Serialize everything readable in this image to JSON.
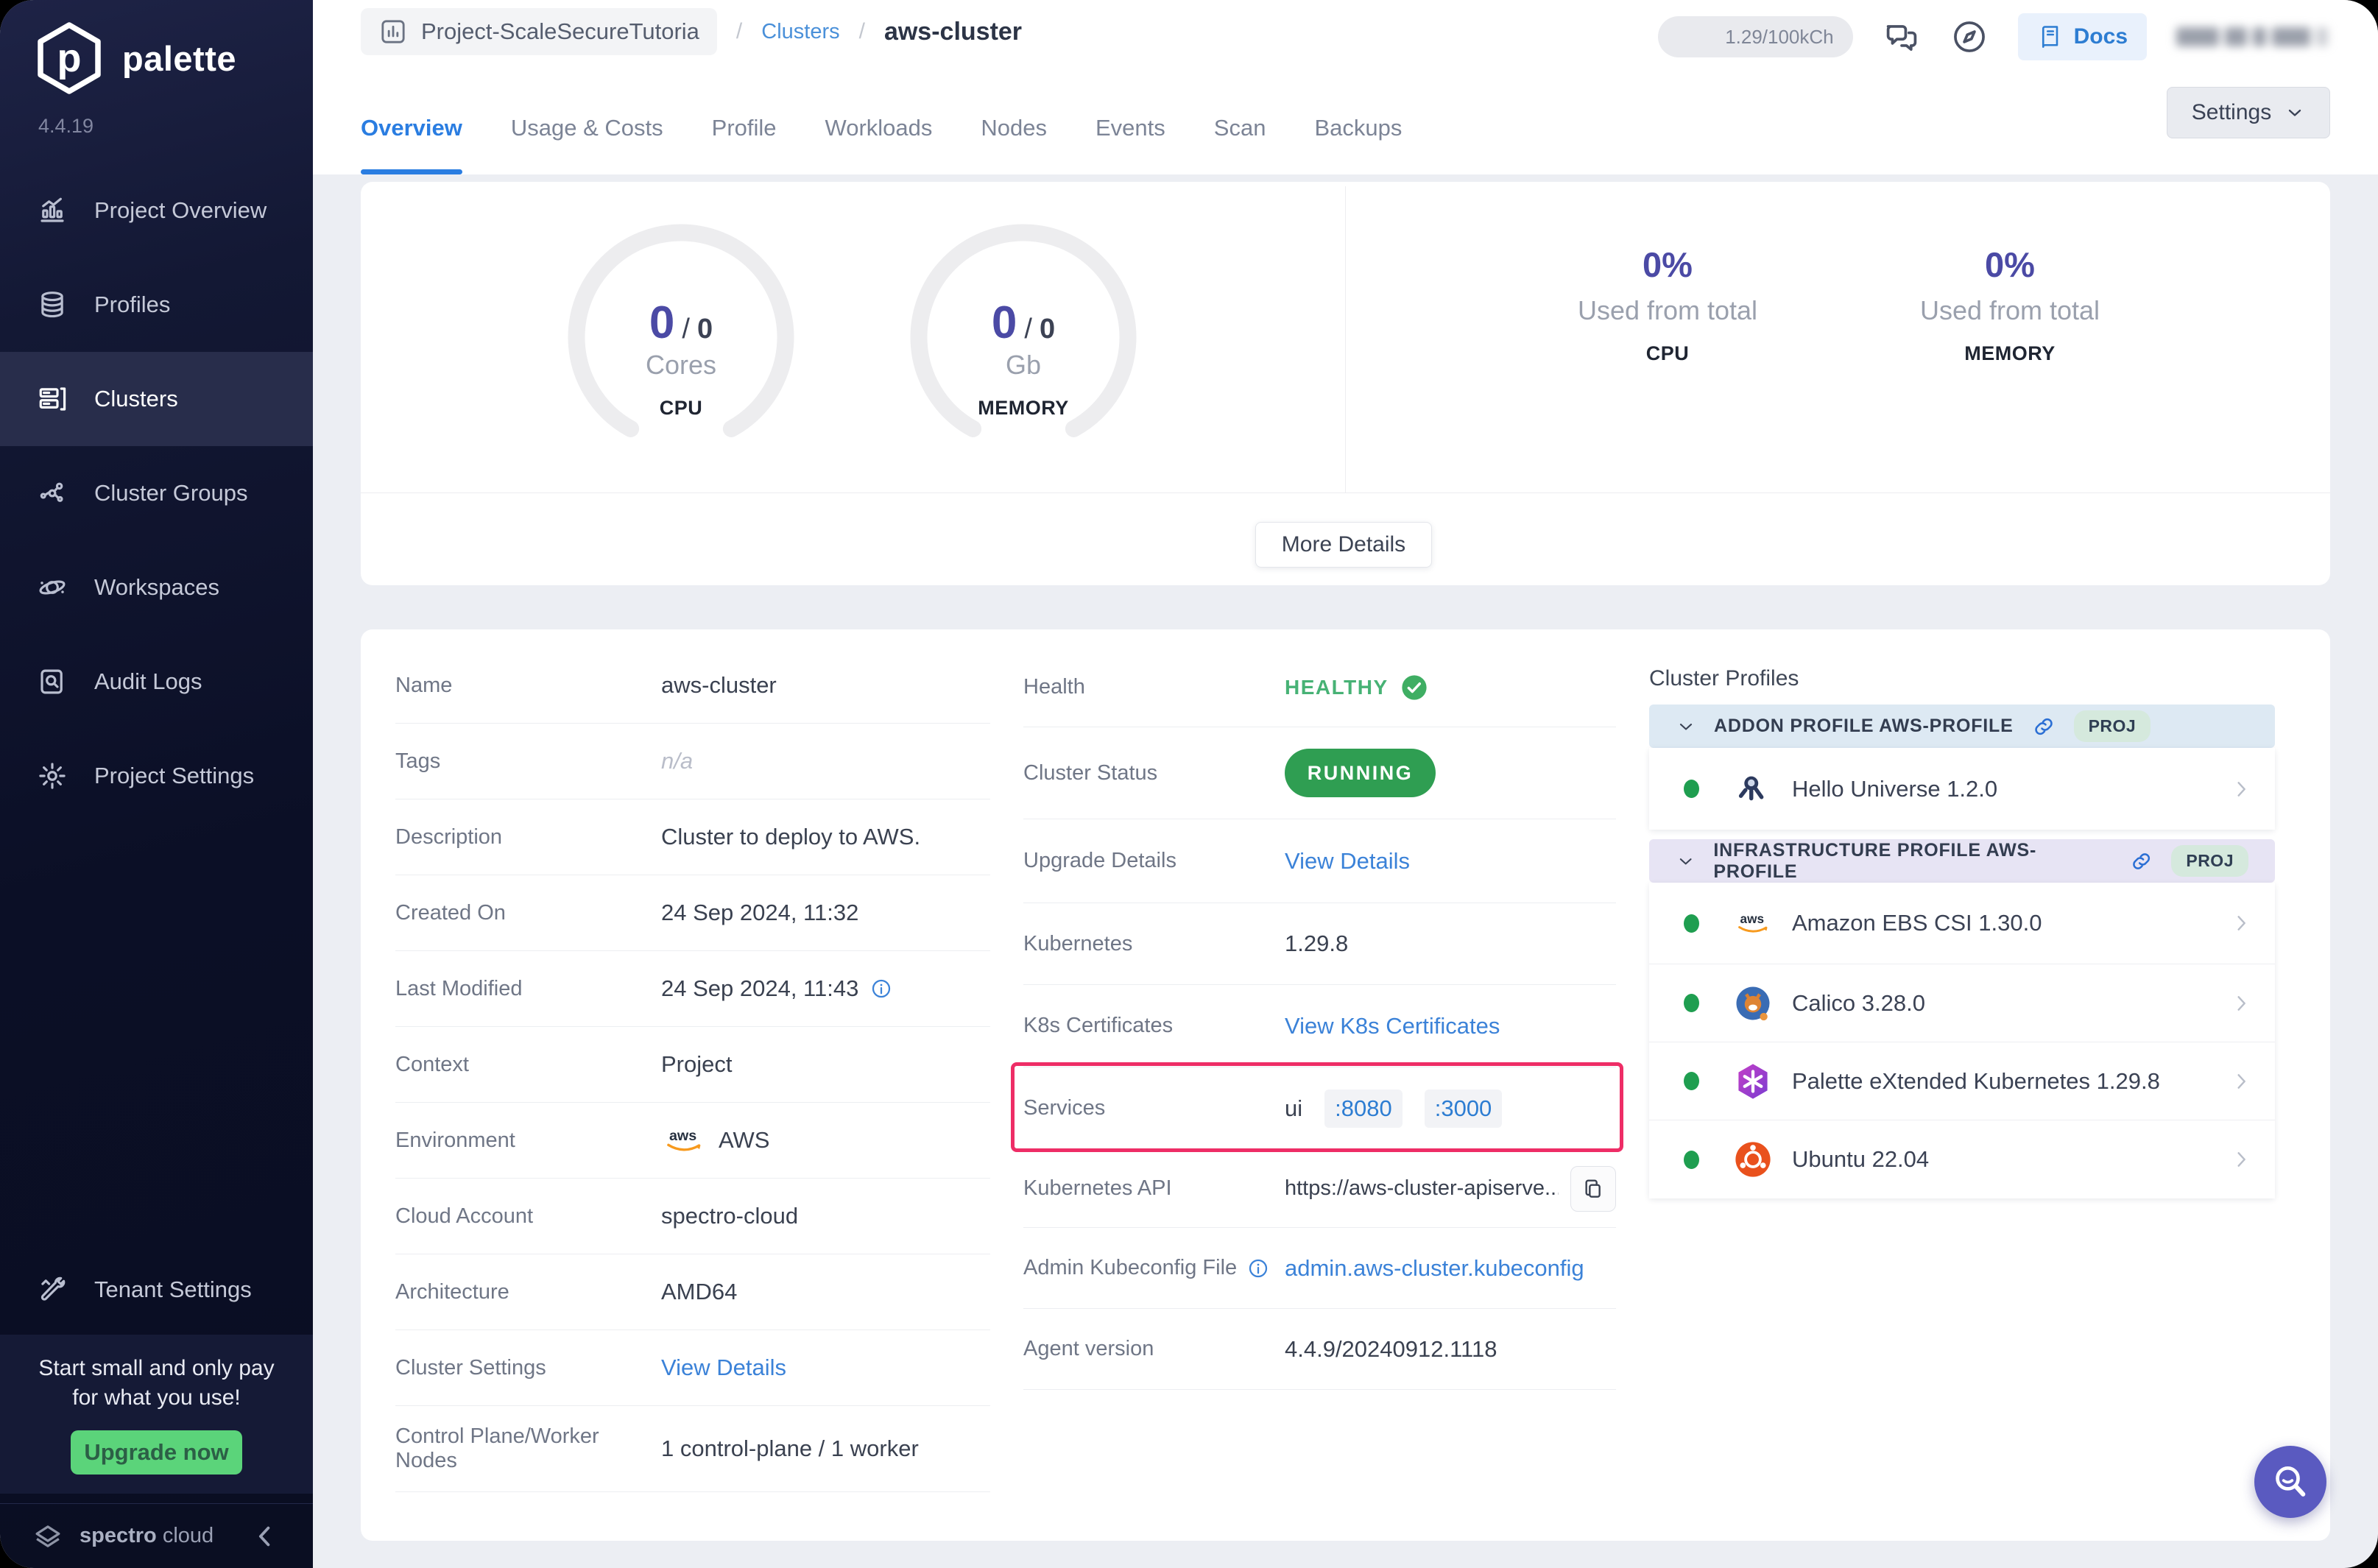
{
  "colors": {
    "accent_blue": "#2a7de1",
    "link_blue": "#3b82d8",
    "purple_metric": "#4b4aa5",
    "status_green": "#2f9e52",
    "healthy_green": "#47b275",
    "pink_highlight": "#ee2d66",
    "upgrade_green": "#5bd47a",
    "sidebar_navy": "#0d1128",
    "help_fab_purple": "#5a5ac0"
  },
  "sidebar": {
    "brand": "palette",
    "version": "4.4.19",
    "items": [
      {
        "label": "Project Overview",
        "icon": "project-overview",
        "active": false
      },
      {
        "label": "Profiles",
        "icon": "profiles",
        "active": false
      },
      {
        "label": "Clusters",
        "icon": "clusters",
        "active": true
      },
      {
        "label": "Cluster Groups",
        "icon": "cluster-groups",
        "active": false
      },
      {
        "label": "Workspaces",
        "icon": "workspaces",
        "active": false
      },
      {
        "label": "Audit Logs",
        "icon": "audit-logs",
        "active": false
      },
      {
        "label": "Project Settings",
        "icon": "project-settings",
        "active": false
      }
    ],
    "tenant": {
      "label": "Tenant Settings",
      "icon": "tools"
    },
    "promo": {
      "line1": "Start small and only pay",
      "line2": "for what you use!",
      "button": "Upgrade now"
    },
    "footer": {
      "brand_primary": "spectro",
      "brand_secondary": "cloud"
    }
  },
  "header": {
    "breadcrumb": {
      "project": "Project-ScaleSecureTutoria",
      "separator": "/",
      "section": "Clusters",
      "current": "aws-cluster"
    },
    "usage_pill": "1.29/100kCh",
    "docs_label": "Docs",
    "settings_label": "Settings"
  },
  "tabs": [
    {
      "label": "Overview",
      "active": true
    },
    {
      "label": "Usage & Costs",
      "active": false
    },
    {
      "label": "Profile",
      "active": false
    },
    {
      "label": "Workloads",
      "active": false
    },
    {
      "label": "Nodes",
      "active": false
    },
    {
      "label": "Events",
      "active": false
    },
    {
      "label": "Scan",
      "active": false
    },
    {
      "label": "Backups",
      "active": false
    }
  ],
  "overview_card": {
    "ratio_separator": "/",
    "gauges": [
      {
        "used": "0",
        "total": "0",
        "unit": "Cores",
        "caption": "CPU"
      },
      {
        "used": "0",
        "total": "0",
        "unit": "Gb",
        "caption": "MEMORY"
      }
    ],
    "usage_stats": [
      {
        "percent": "0%",
        "caption": "Used from total",
        "metric": "CPU"
      },
      {
        "percent": "0%",
        "caption": "Used from total",
        "metric": "MEMORY"
      }
    ],
    "more_details_label": "More Details"
  },
  "details": {
    "left_rows": [
      {
        "label": "Name",
        "type": "text",
        "value": "aws-cluster"
      },
      {
        "label": "Tags",
        "type": "muted",
        "value": "n/a"
      },
      {
        "label": "Description",
        "type": "text",
        "value": "Cluster to deploy to AWS."
      },
      {
        "label": "Created On",
        "type": "text",
        "value": "24 Sep 2024, 11:32"
      },
      {
        "label": "Last Modified",
        "type": "text-info",
        "value": "24 Sep 2024, 11:43"
      },
      {
        "label": "Context",
        "type": "text",
        "value": "Project"
      },
      {
        "label": "Environment",
        "type": "aws-text",
        "value": "AWS"
      },
      {
        "label": "Cloud Account",
        "type": "text",
        "value": "spectro-cloud"
      },
      {
        "label": "Architecture",
        "type": "text",
        "value": "AMD64"
      },
      {
        "label": "Cluster Settings",
        "type": "link",
        "value": "View Details"
      },
      {
        "label": "Control Plane/Worker Nodes",
        "type": "text",
        "value": "1 control-plane / 1 worker"
      }
    ],
    "middle_rows": [
      {
        "label": "Health",
        "type": "health",
        "value": "HEALTHY"
      },
      {
        "label": "Cluster Status",
        "type": "running",
        "value": "RUNNING"
      },
      {
        "label": "Upgrade Details",
        "type": "link",
        "value": "View Details"
      },
      {
        "label": "Kubernetes",
        "type": "text",
        "value": "1.29.8"
      },
      {
        "label": "K8s Certificates",
        "type": "link",
        "value": "View K8s Certificates"
      },
      {
        "label": "Services",
        "type": "services",
        "service_name": "ui",
        "ports": [
          ":8080",
          ":3000"
        ],
        "highlighted": true
      },
      {
        "label": "Kubernetes API",
        "type": "api",
        "value": "https://aws-cluster-apiserve..."
      },
      {
        "label": "Admin Kubeconfig File",
        "type": "kubeconfig",
        "label_info": true,
        "value": "admin.aws-cluster.kubeconfig"
      },
      {
        "label": "Agent version",
        "type": "text",
        "value": "4.4.9/20240912.1118"
      }
    ]
  },
  "cluster_profiles": {
    "title": "Cluster Profiles",
    "sections": [
      {
        "header": "ADDON PROFILE AWS-PROFILE",
        "badge": "PROJ",
        "theme": "blue",
        "items": [
          {
            "name": "Hello Universe 1.2.0",
            "icon": "hello-universe",
            "status": "green"
          }
        ]
      },
      {
        "header": "INFRASTRUCTURE PROFILE AWS-PROFILE",
        "badge": "PROJ",
        "theme": "purple",
        "items": [
          {
            "name": "Amazon EBS CSI 1.30.0",
            "icon": "aws",
            "status": "green"
          },
          {
            "name": "Calico 3.28.0",
            "icon": "calico",
            "status": "green"
          },
          {
            "name": "Palette eXtended Kubernetes 1.29.8",
            "icon": "pxk",
            "status": "green"
          },
          {
            "name": "Ubuntu 22.04",
            "icon": "ubuntu",
            "status": "green"
          }
        ]
      }
    ]
  }
}
